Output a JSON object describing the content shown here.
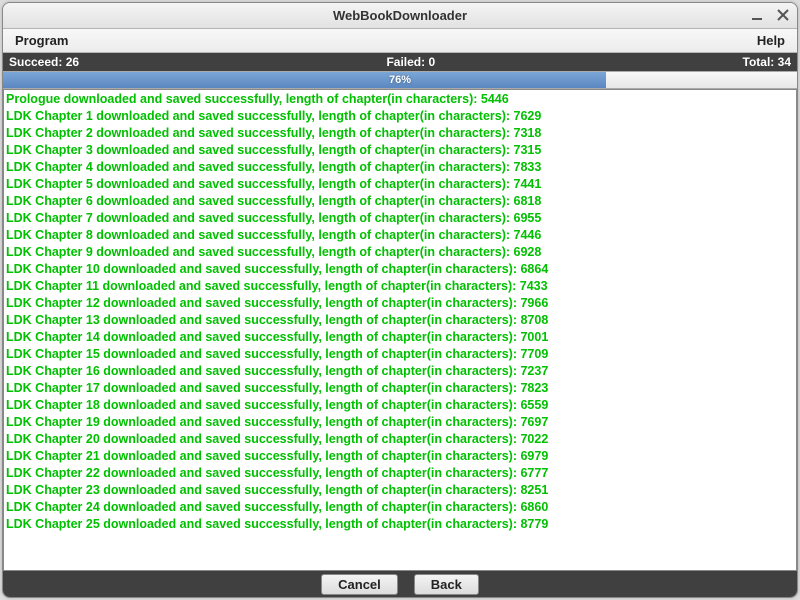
{
  "window": {
    "title": "WebBookDownloader"
  },
  "menubar": {
    "program": "Program",
    "help": "Help"
  },
  "status": {
    "succeed_label": "Succeed:",
    "succeed_count": "26",
    "failed_label": "Failed:",
    "failed_count": "0",
    "total_label": "Total:",
    "total_count": "34"
  },
  "progress": {
    "percent": 76,
    "label": "76%"
  },
  "log": [
    "Prologue downloaded and saved successfully, length of chapter(in characters): 5446",
    "LDK Chapter 1 downloaded and saved successfully, length of chapter(in characters): 7629",
    "LDK Chapter 2 downloaded and saved successfully, length of chapter(in characters): 7318",
    "LDK Chapter 3 downloaded and saved successfully, length of chapter(in characters): 7315",
    "LDK Chapter 4 downloaded and saved successfully, length of chapter(in characters): 7833",
    "LDK Chapter 5 downloaded and saved successfully, length of chapter(in characters): 7441",
    "LDK Chapter 6 downloaded and saved successfully, length of chapter(in characters): 6818",
    "LDK Chapter 7 downloaded and saved successfully, length of chapter(in characters): 6955",
    "LDK Chapter 8 downloaded and saved successfully, length of chapter(in characters): 7446",
    "LDK Chapter 9 downloaded and saved successfully, length of chapter(in characters): 6928",
    "LDK Chapter 10 downloaded and saved successfully, length of chapter(in characters): 6864",
    "LDK Chapter 11 downloaded and saved successfully, length of chapter(in characters): 7433",
    "LDK Chapter 12 downloaded and saved successfully, length of chapter(in characters): 7966",
    "LDK Chapter 13 downloaded and saved successfully, length of chapter(in characters): 8708",
    "LDK Chapter 14 downloaded and saved successfully, length of chapter(in characters): 7001",
    "LDK Chapter 15 downloaded and saved successfully, length of chapter(in characters): 7709",
    "LDK Chapter 16 downloaded and saved successfully, length of chapter(in characters): 7237",
    "LDK Chapter 17 downloaded and saved successfully, length of chapter(in characters): 7823",
    "LDK Chapter 18 downloaded and saved successfully, length of chapter(in characters): 6559",
    "LDK Chapter 19 downloaded and saved successfully, length of chapter(in characters): 7697",
    "LDK Chapter 20 downloaded and saved successfully, length of chapter(in characters): 7022",
    "LDK Chapter 21 downloaded and saved successfully, length of chapter(in characters): 6979",
    "LDK Chapter 22 downloaded and saved successfully, length of chapter(in characters): 6777",
    "LDK Chapter 23 downloaded and saved successfully, length of chapter(in characters): 8251",
    "LDK Chapter 24 downloaded and saved successfully, length of chapter(in characters): 6860",
    "LDK Chapter 25 downloaded and saved successfully, length of chapter(in characters): 8779"
  ],
  "bottom": {
    "cancel": "Cancel",
    "back": "Back"
  }
}
